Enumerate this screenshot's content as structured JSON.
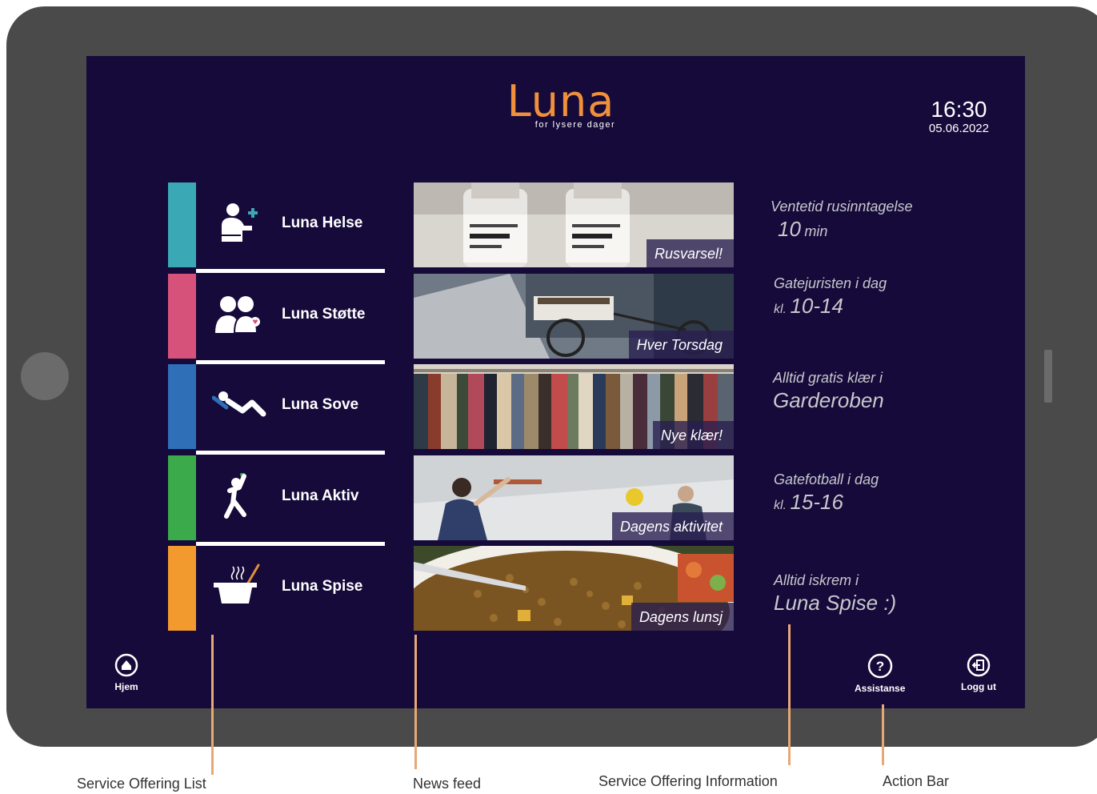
{
  "header": {
    "logo": "Luna",
    "tagline": "for lysere dager",
    "time": "16:30",
    "date": "05.06.2022"
  },
  "services": [
    {
      "label": "Luna Helse",
      "color": "#3aa9b5",
      "icon": "health-person-icon"
    },
    {
      "label": "Luna Støtte",
      "color": "#d6527a",
      "icon": "support-people-icon"
    },
    {
      "label": "Luna Sove",
      "color": "#2f6fb7",
      "icon": "sleep-person-icon"
    },
    {
      "label": "Luna Aktiv",
      "color": "#3aaa4a",
      "icon": "active-person-icon"
    },
    {
      "label": "Luna Spise",
      "color": "#f39a2e",
      "icon": "cooking-pot-icon"
    }
  ],
  "news": [
    {
      "caption": "Rusvarsel!"
    },
    {
      "caption": "Hver Torsdag"
    },
    {
      "caption": "Nye klær!"
    },
    {
      "caption": "Dagens aktivitet"
    },
    {
      "caption": "Dagens lunsj"
    }
  ],
  "info": [
    {
      "line1": "Ventetid rusinntagelse",
      "value": "10",
      "unit": "min"
    },
    {
      "line1": "Gatejuristen i dag",
      "prefix": "kl.",
      "value": "10-14"
    },
    {
      "line1": "Alltid gratis klær i",
      "value": "Garderoben"
    },
    {
      "line1": "Gatefotball i dag",
      "prefix": "kl.",
      "value": "15-16"
    },
    {
      "line1": "Alltid iskrem i",
      "value": "Luna Spise :)"
    }
  ],
  "actions": {
    "home": "Hjem",
    "assist": "Assistanse",
    "logout": "Logg ut"
  },
  "annotations": {
    "services": "Service Offering List",
    "news": "News feed",
    "info": "Service Offering Information",
    "actions": "Action Bar"
  }
}
